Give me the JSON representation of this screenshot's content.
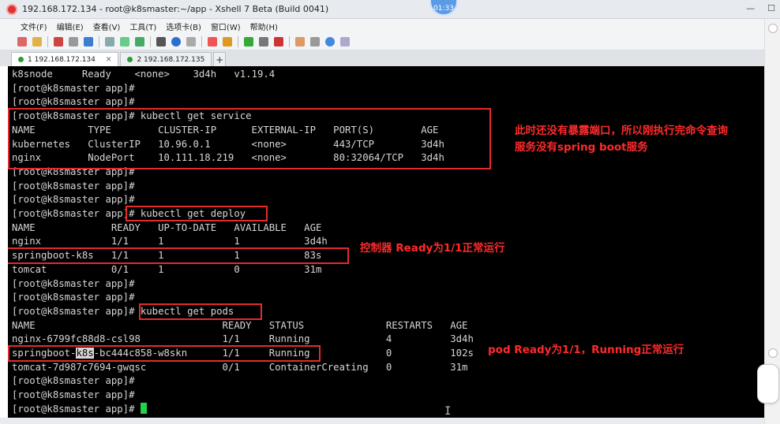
{
  "window": {
    "title": "192.168.172.134 - root@k8smaster:~/app - Xshell 7 Beta (Build 0041)",
    "clock": "01:33"
  },
  "menu": [
    "文件(F)",
    "编辑(E)",
    "查看(V)",
    "工具(T)",
    "选项卡(B)",
    "窗口(W)",
    "帮助(H)"
  ],
  "tabs": [
    {
      "label": "1 192.168.172.134",
      "active": true
    },
    {
      "label": "2 192.168.172.135",
      "active": false
    }
  ],
  "terminal": {
    "lines": [
      "k8snode     Ready    <none>    3d4h   v1.19.4",
      "[root@k8smaster app]#",
      "[root@k8smaster app]#",
      "[root@k8smaster app]# kubectl get service",
      "NAME         TYPE        CLUSTER-IP      EXTERNAL-IP   PORT(S)        AGE",
      "kubernetes   ClusterIP   10.96.0.1       <none>        443/TCP        3d4h",
      "nginx        NodePort    10.111.18.219   <none>        80:32064/TCP   3d4h",
      "[root@k8smaster app]#",
      "[root@k8smaster app]#",
      "[root@k8smaster app]#",
      "[root@k8smaster app]# kubectl get deploy",
      "NAME             READY   UP-TO-DATE   AVAILABLE   AGE",
      "nginx            1/1     1            1           3d4h",
      "springboot-k8s   1/1     1            1           83s",
      "tomcat           0/1     1            0           31m",
      "[root@k8smaster app]#",
      "[root@k8smaster app]#",
      "[root@k8smaster app]# kubectl get pods",
      "NAME                                READY   STATUS              RESTARTS   AGE",
      "nginx-6799fc88d8-csl98              1/1     Running             4          3d4h",
      "springboot-k8s-bc444c858-w8skn      1/1     Running             0          102s",
      "tomcat-7d987c7694-gwqsc             0/1     ContainerCreating   0          31m",
      "[root@k8smaster app]#",
      "[root@k8smaster app]#",
      "[root@k8smaster app]# "
    ],
    "highlight": {
      "line": 20,
      "before": "springboot-",
      "mark": "k8s",
      "after": "-bc444c858-w8skn      1/1     Running             0          102s"
    }
  },
  "annotations": {
    "service_note_1": "此时还没有暴露端口，所以刚执行完命令查询",
    "service_note_2": "服务没有spring boot服务",
    "deploy_note": "控制器 Ready为1/1正常运行",
    "pods_note": "pod Ready为1/1，Running正常运行"
  },
  "colors": {
    "terminal_bg": "#000000",
    "annotation": "#ff2a2a",
    "cursor": "#22d34a"
  }
}
